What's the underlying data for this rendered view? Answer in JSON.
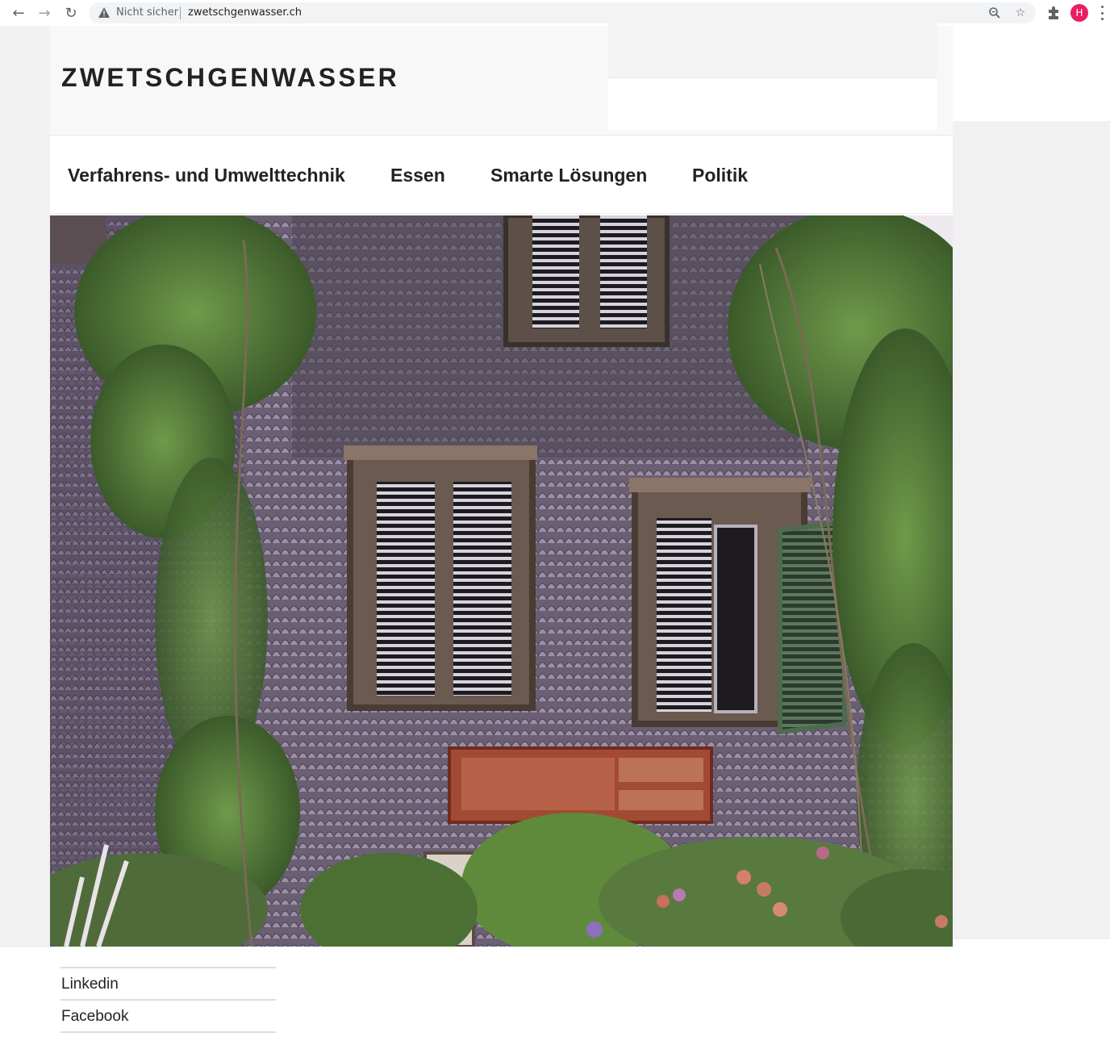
{
  "browser": {
    "security_label": "Nicht sicher",
    "url": "zwetschgenwasser.ch",
    "profile_initial": "H",
    "icons": [
      "back-arrow-icon",
      "forward-arrow-icon",
      "reload-icon",
      "warning-icon",
      "zoom-icon",
      "star-icon",
      "extensions-icon",
      "kebab-menu-icon"
    ]
  },
  "site": {
    "title": "ZWETSCHGENWASSER"
  },
  "nav": {
    "items": [
      {
        "label": "Verfahrens- und Umwelttechnik"
      },
      {
        "label": "Essen"
      },
      {
        "label": "Smarte Lösungen"
      },
      {
        "label": "Politik"
      }
    ]
  },
  "social": {
    "items": [
      {
        "label": "Linkedin"
      },
      {
        "label": "Facebook"
      }
    ]
  },
  "colors": {
    "accent_avatar": "#e91e63",
    "text": "#222222",
    "page_bg": "#f1f1f1"
  }
}
